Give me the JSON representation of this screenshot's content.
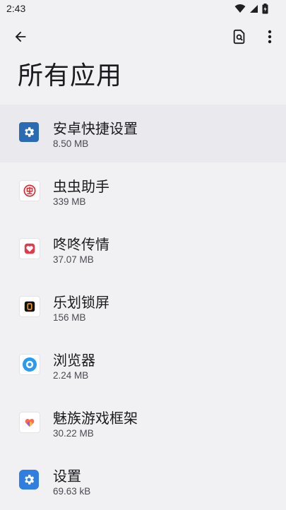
{
  "status_bar": {
    "time": "2:43",
    "icons": [
      "wifi-icon",
      "cell-signal-icon",
      "battery-charging-icon"
    ]
  },
  "toolbar": {
    "back_icon": "arrow-back-icon",
    "search_icon": "search-document-icon",
    "more_icon": "more-vert-icon"
  },
  "page": {
    "title": "所有应用"
  },
  "apps": [
    {
      "name": "安卓快捷设置",
      "size": "8.50 MB",
      "icon": "gear-icon",
      "color": "#2a6bb3"
    },
    {
      "name": "虫虫助手",
      "size": "339 MB",
      "icon": "chongchong-logo-icon",
      "color": "#d8262c"
    },
    {
      "name": "咚咚传情",
      "size": "37.07 MB",
      "icon": "heart-icon",
      "color": "#e23a4b"
    },
    {
      "name": "乐划锁屏",
      "size": "156 MB",
      "icon": "lock-screen-icon",
      "color": "#f39c12"
    },
    {
      "name": "浏览器",
      "size": "2.24 MB",
      "icon": "browser-icon",
      "color": "#2a9bf0"
    },
    {
      "name": "魅族游戏框架",
      "size": "30.22 MB",
      "icon": "game-framework-icon",
      "color": "#ff6a4a"
    },
    {
      "name": "设置",
      "size": "69.63 kB",
      "icon": "settings-gear-icon",
      "color": "#2f7ee0"
    }
  ]
}
